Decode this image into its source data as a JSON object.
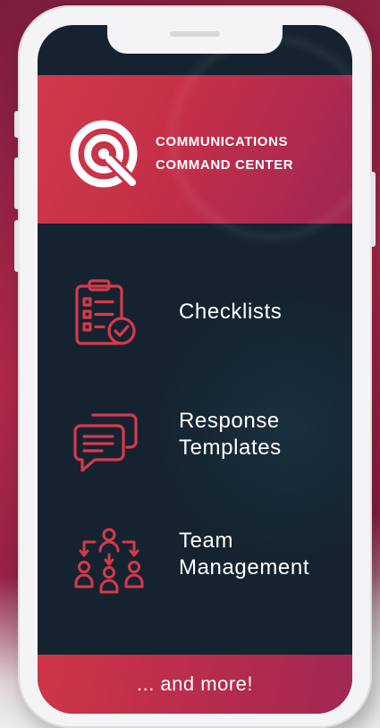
{
  "brand": {
    "line1": "COMMUNICATIONS",
    "line2": "COMMAND CENTER",
    "logo_icon": "target-q-logo-icon"
  },
  "features": [
    {
      "line1": "Checklists",
      "line2": "",
      "icon": "clipboard-checklist-icon"
    },
    {
      "line1": "Response",
      "line2": "Templates",
      "icon": "chat-bubbles-icon"
    },
    {
      "line1": "Team",
      "line2": "Management",
      "icon": "team-hierarchy-icon"
    }
  ],
  "footer": {
    "text": "... and more!"
  },
  "colors": {
    "accent": "#d13a4c",
    "screen_bg": "#14232f",
    "icon_stroke": "#d8384d",
    "phone_frame": "#f4f4f6"
  }
}
